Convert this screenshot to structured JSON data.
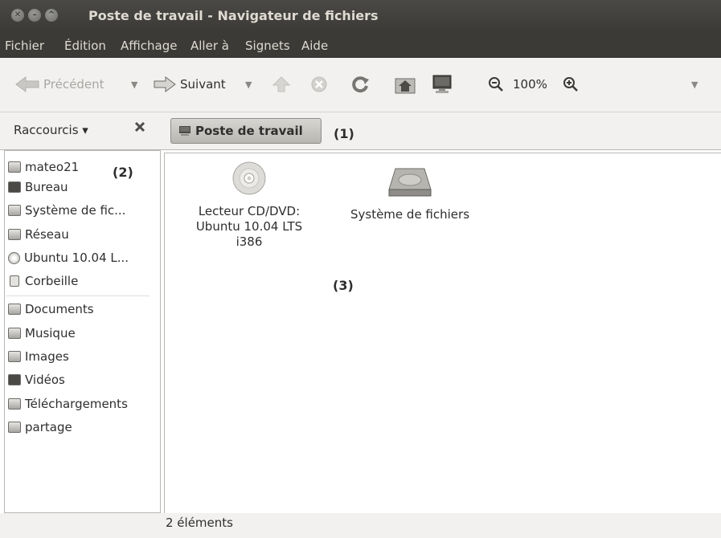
{
  "window": {
    "title": "Poste de travail - Navigateur de fichiers",
    "buttons": [
      "close",
      "minimize",
      "maximize"
    ]
  },
  "menubar": {
    "items": [
      "Fichier",
      "Édition",
      "Affichage",
      "Aller à",
      "Signets",
      "Aide"
    ]
  },
  "toolbar": {
    "back_label": "Précédent",
    "forward_label": "Suivant",
    "zoom_level": "100%"
  },
  "sidebar_header": {
    "label": "Raccourcis ▾"
  },
  "location": {
    "current": "Poste de travail"
  },
  "sidebar": {
    "items": [
      {
        "label": "mateo21",
        "icon": "home-folder-icon"
      },
      {
        "label": "Bureau",
        "icon": "desktop-icon"
      },
      {
        "label": "Système de fic...",
        "icon": "filesystem-icon"
      },
      {
        "label": "Réseau",
        "icon": "network-icon"
      },
      {
        "label": "Ubuntu 10.04 L...",
        "icon": "cd-icon"
      },
      {
        "label": "Corbeille",
        "icon": "trash-icon"
      }
    ],
    "bookmarks": [
      {
        "label": "Documents",
        "icon": "documents-folder-icon"
      },
      {
        "label": "Musique",
        "icon": "music-folder-icon"
      },
      {
        "label": "Images",
        "icon": "images-folder-icon"
      },
      {
        "label": "Vidéos",
        "icon": "videos-folder-icon"
      },
      {
        "label": "Téléchargements",
        "icon": "downloads-folder-icon"
      },
      {
        "label": "partage",
        "icon": "folder-icon"
      }
    ]
  },
  "files": [
    {
      "label_lines": [
        "Lecteur CD/DVD:",
        "Ubuntu 10.04 LTS",
        "i386"
      ],
      "icon": "cd-disc-icon"
    },
    {
      "label_lines": [
        "Système de fichiers"
      ],
      "icon": "hard-drive-icon"
    }
  ],
  "annotations": {
    "one": "(1)",
    "two": "(2)",
    "three": "(3)"
  },
  "status": {
    "text": "2 éléments"
  }
}
